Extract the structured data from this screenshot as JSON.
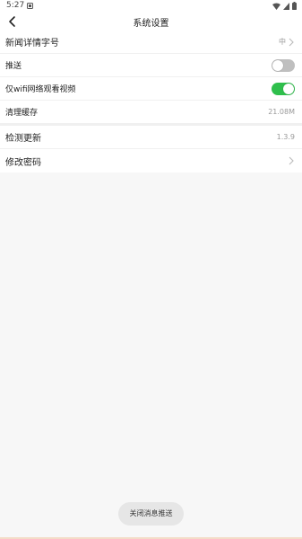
{
  "status_bar": {
    "time": "5:27",
    "icons": [
      "notification-icon",
      "wifi-icon",
      "signal-icon",
      "battery-icon"
    ]
  },
  "header": {
    "title": "系统设置",
    "back_icon": "back-arrow-icon"
  },
  "settings_group_1": [
    {
      "label": "新闻详情字号",
      "value": "中",
      "chevron": true
    },
    {
      "label": "推送",
      "toggle": false
    },
    {
      "label": "仅wifi网络观看视频",
      "toggle": true
    },
    {
      "label": "清理缓存",
      "value": "21.08M"
    }
  ],
  "settings_group_2": [
    {
      "label": "检测更新",
      "value": "1.3.9"
    },
    {
      "label": "修改密码",
      "chevron": true
    }
  ],
  "toast": {
    "text": "关闭消息推送"
  },
  "colors": {
    "toggle_on": "#2fbf4c",
    "toggle_off": "#bfbfbf",
    "background": "#f7f7f7"
  }
}
